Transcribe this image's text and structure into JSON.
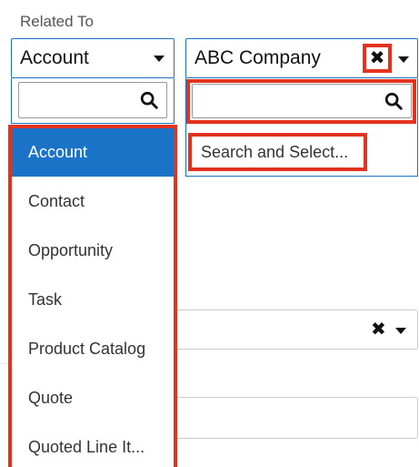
{
  "field": {
    "label": "Related To"
  },
  "module_select": {
    "selected": "Account",
    "options": [
      "Account",
      "Contact",
      "Opportunity",
      "Task",
      "Product Catalog",
      "Quote",
      "Quoted Line It..."
    ],
    "active_index": 0
  },
  "record_select": {
    "selected": "ABC Company",
    "clear_icon": "close-icon",
    "search_placeholder": "",
    "search_and_select_label": "Search and Select..."
  },
  "colors": {
    "accent": "#1a73c7",
    "highlight": "#e3321e"
  }
}
